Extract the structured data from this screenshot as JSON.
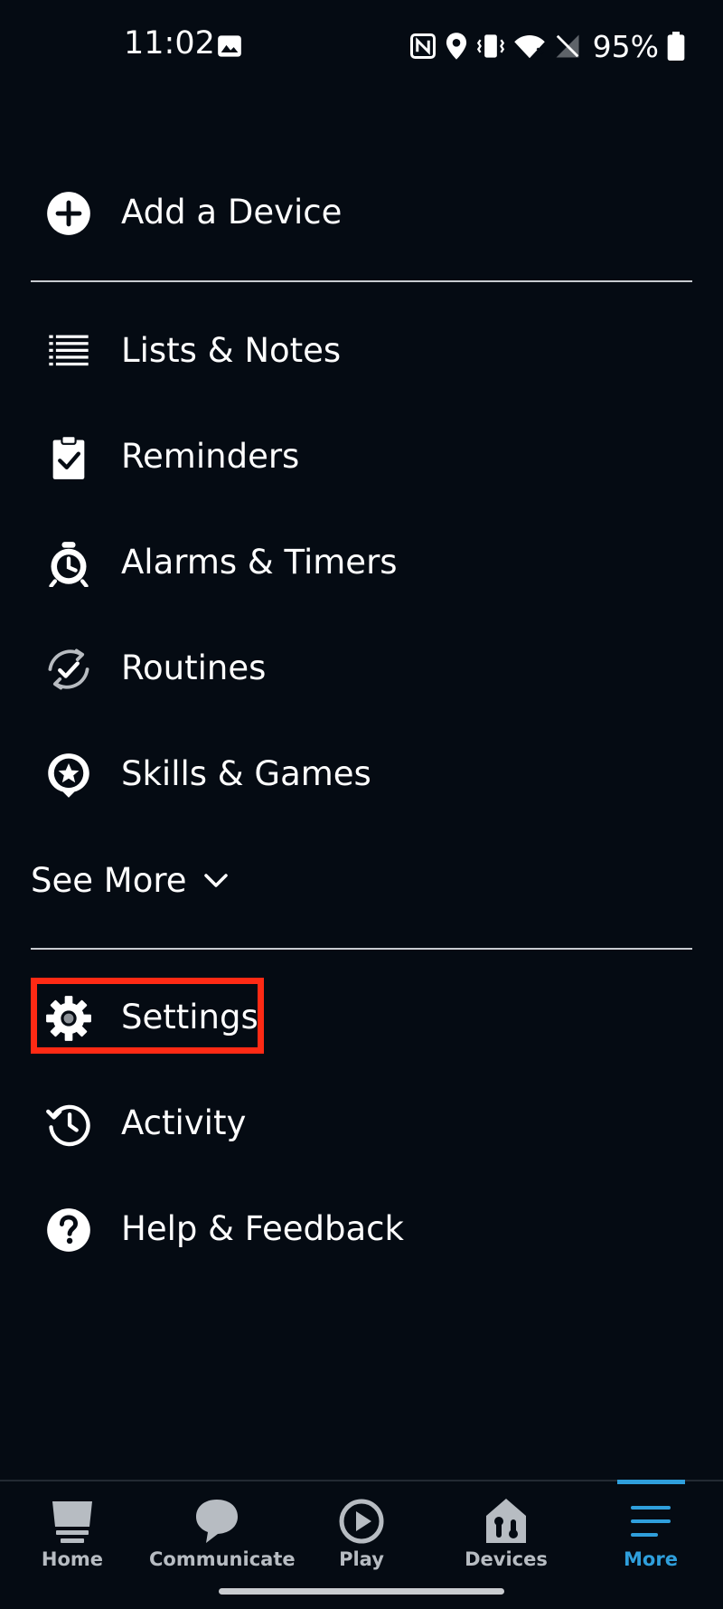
{
  "status_bar": {
    "time": "11:02",
    "battery": "95%"
  },
  "menu": {
    "add_device": "Add a Device",
    "lists_notes": "Lists & Notes",
    "reminders": "Reminders",
    "alarms_timers": "Alarms & Timers",
    "routines": "Routines",
    "skills_games": "Skills & Games",
    "see_more": "See More",
    "settings": "Settings",
    "activity": "Activity",
    "help_feedback": "Help & Feedback"
  },
  "bottom_nav": {
    "home": "Home",
    "communicate": "Communicate",
    "play": "Play",
    "devices": "Devices",
    "more": "More",
    "active_tab": "More"
  },
  "colors": {
    "background": "#050b13",
    "accent": "#2f9fdc",
    "highlight": "#ff2a14"
  }
}
